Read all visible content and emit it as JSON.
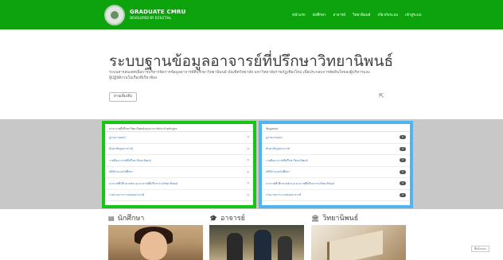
{
  "brand": {
    "title": "GRADUATE CMRU",
    "sub_prefix": "DEVELOPED BY",
    "sub_suffix": "DIGITAL"
  },
  "nav": {
    "items": [
      "หน้าแรก",
      "นักศึกษา",
      "อาจารย์",
      "วิทยานิพนธ์",
      "เกี่ยวกับระบบ",
      "เข้าสู่ระบบ"
    ]
  },
  "hero": {
    "title": "ระบบฐานข้อมูลอาจารย์ที่ปรึกษาวิทยานิพนธ์",
    "description": "ระบบสารสนเทศเพื่อการบริหารจัดการข้อมูลอาจารย์ที่ปรึกษาวิทยานิพนธ์ บัณฑิตวิทยาลัย มหาวิทยาลัยราชภัฏเชียงใหม่ เพื่อประกอบการตัดสินใจของผู้บริหารและผู้ปฏิบัติงานในเรื่องที่เกี่ยวข้อง",
    "button_label": "อ่านเพิ่มเติม"
  },
  "panel_left": {
    "header": "ภาระงานที่ปรึกษาวิทยานิพนธ์ของอาจารย์ประจำหลักสูตร",
    "rows": [
      "ดูรายงานสรุป",
      "ค้นหาข้อมูลอาจารย์",
      "รายชื่ออาจารย์ที่ปรึกษาวิทยานิพนธ์",
      "สถิติจำนวนนักศึกษา",
      "อาจารย์ที่ปรึกษาหลักและอาจารย์ที่ปรึกษาร่วมวิทยานิพนธ์",
      "รายงานภาระงานของอาจารย์"
    ]
  },
  "panel_right": {
    "header": "ข้อมูลสรุป",
    "rows": [
      {
        "label": "ดูรายงานสรุป",
        "badge": "0"
      },
      {
        "label": "ค้นหาข้อมูลอาจารย์",
        "badge": "0"
      },
      {
        "label": "รายชื่ออาจารย์ที่ปรึกษาวิทยานิพนธ์",
        "badge": "0"
      },
      {
        "label": "สถิติจำนวนนักศึกษา",
        "badge": "0"
      },
      {
        "label": "อาจารย์ที่ปรึกษาหลักและอาจารย์ที่ปรึกษาร่วมวิทยานิพนธ์",
        "badge": "0"
      },
      {
        "label": "รายงานภาระงานของอาจารย์",
        "badge": "0"
      }
    ]
  },
  "sections": [
    {
      "icon": "id-card-icon",
      "label": "นักศึกษา"
    },
    {
      "icon": "graduation-cap-icon",
      "label": "อาจารย์"
    },
    {
      "icon": "institution-icon",
      "label": "วิทยานิพนธ์"
    }
  ],
  "float_button": "ขึ้นด้านบน",
  "colors": {
    "topbar": "#0da30d",
    "panel_left_border": "#17c517",
    "panel_right_border": "#4fb4f0",
    "band": "#c8c8c8"
  }
}
